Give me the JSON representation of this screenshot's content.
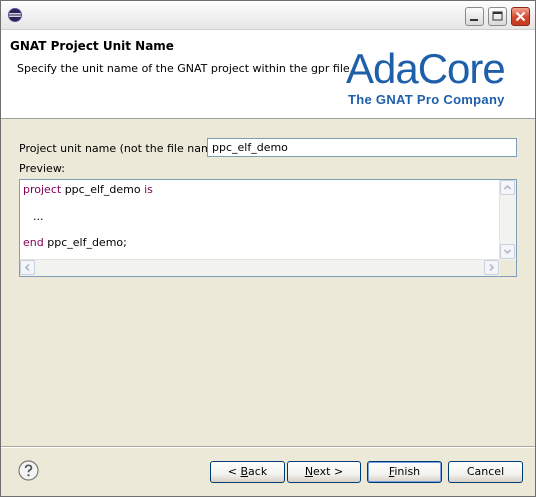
{
  "window": {
    "header_title": "GNAT Project Unit Name",
    "header_description": "Specify the unit name of the GNAT project within the gpr file.",
    "logo_main": "AdaCore",
    "logo_sub": "The GNAT Pro Company"
  },
  "form": {
    "unit_label": "Project unit name (not the file name):",
    "unit_value": "ppc_elf_demo",
    "preview_label": "Preview:"
  },
  "preview": {
    "line1_kw": "project",
    "line1_name": "ppc_elf_demo",
    "line1_kw2": "is",
    "line2": "...",
    "line3_kw": "end",
    "line3_rest": "ppc_elf_demo;"
  },
  "buttons": {
    "back_prefix": "< ",
    "back_mnemonic": "B",
    "back_rest": "ack",
    "next_mnemonic": "N",
    "next_rest": "ext >",
    "finish_mnemonic": "F",
    "finish_rest": "inish",
    "cancel": "Cancel"
  },
  "colors": {
    "keyword": "#7f0055",
    "brand": "#1e5faa"
  },
  "icons": [
    "eclipse-app-icon",
    "minimize-icon",
    "maximize-icon",
    "close-icon",
    "help-icon",
    "scroll-up-icon",
    "scroll-down-icon",
    "scroll-left-icon",
    "scroll-right-icon"
  ]
}
